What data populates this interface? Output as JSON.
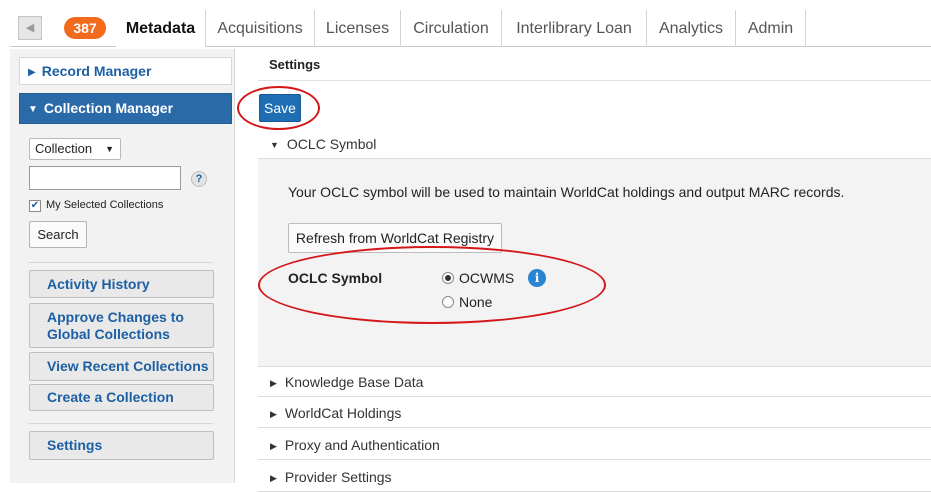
{
  "topnav": {
    "collapse_icon": "collapse-left-icon",
    "count_badge": "387",
    "tabs": [
      {
        "label": "Metadata",
        "active": true
      },
      {
        "label": "Acquisitions",
        "active": false
      },
      {
        "label": "Licenses",
        "active": false
      },
      {
        "label": "Circulation",
        "active": false
      },
      {
        "label": "Interlibrary Loan",
        "active": false
      },
      {
        "label": "Analytics",
        "active": false
      },
      {
        "label": "Admin",
        "active": false
      }
    ]
  },
  "sidebar": {
    "record_manager": "Record Manager",
    "collection_manager": "Collection Manager",
    "search_scope": "Collection",
    "search_input_value": "",
    "help_glyph": "?",
    "my_selected_checked": true,
    "my_selected_label": "My Selected Collections",
    "search_button": "Search",
    "buttons": [
      "Activity History",
      "Approve Changes to Global Collections",
      "View Recent Collections",
      "Create a Collection"
    ],
    "settings_button": "Settings"
  },
  "main": {
    "header": "Settings",
    "save_button": "Save",
    "sections": [
      "OCLC Symbol",
      "Knowledge Base Data",
      "WorldCat Holdings",
      "Proxy and Authentication",
      "Provider Settings"
    ],
    "oclc": {
      "description": "Your OCLC symbol will be used to maintain WorldCat holdings and output MARC records.",
      "refresh_button": "Refresh from WorldCat Registry",
      "field_label": "OCLC Symbol",
      "options": [
        {
          "label": "OCWMS",
          "selected": true
        },
        {
          "label": "None",
          "selected": false
        }
      ],
      "info_glyph": "i"
    }
  },
  "colors": {
    "badge": "#f26b1d",
    "active_panel": "#2b6aa8",
    "link": "#1d5fa3",
    "primary_button": "#1f6db3",
    "annotation": "#d4181a"
  }
}
